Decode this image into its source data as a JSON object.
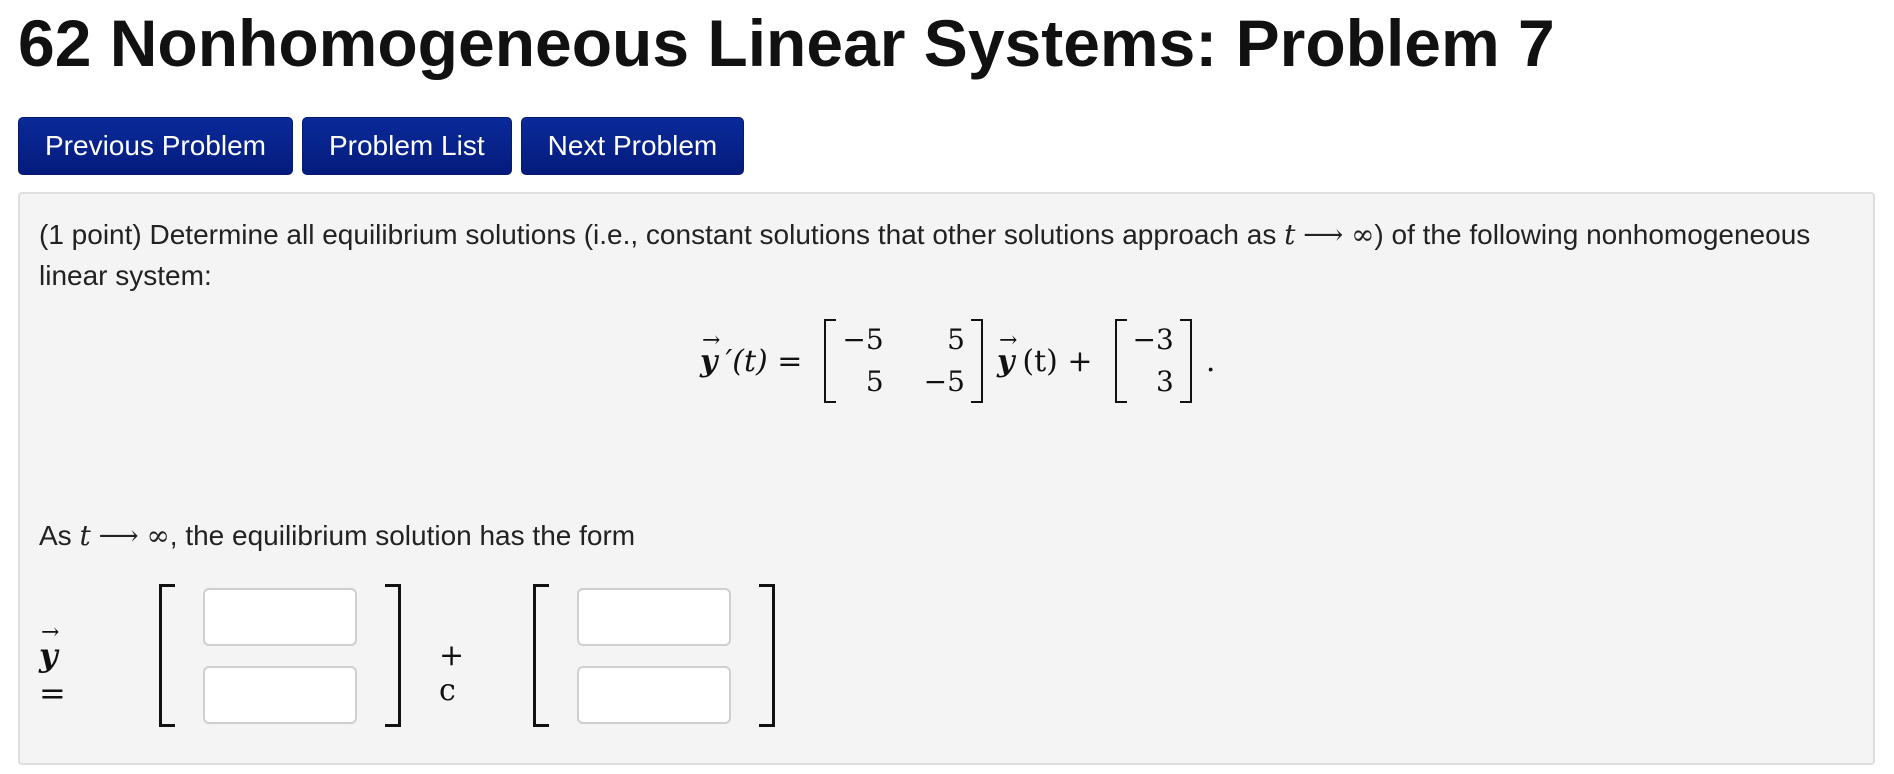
{
  "page": {
    "title": "62 Nonhomogeneous Linear Systems: Problem 7"
  },
  "nav": {
    "previous": "Previous Problem",
    "list": "Problem List",
    "next": "Next Problem"
  },
  "problem": {
    "intro_before": "(1 point) Determine all equilibrium solutions (i.e., constant solutions that other solutions approach as ",
    "t": "t",
    "arrow": "⟶",
    "infinity": "∞",
    "intro_after": ") of the following nonhomogeneous linear system:",
    "equation": {
      "y": "y",
      "vec_arrow": "→",
      "prime_t": "′(t) =",
      "matrix": [
        "−5",
        "5",
        "5",
        "−5"
      ],
      "y_of_t": "(t) +",
      "constant": [
        "−3",
        "3"
      ],
      "period": "."
    },
    "as_before": "As ",
    "as_after": ", the equilibrium solution has the form",
    "answer": {
      "y": "y",
      "vec_arrow": "→",
      "equals": "=",
      "plus_c": "+ c",
      "inputs": [
        "",
        "",
        "",
        ""
      ]
    }
  }
}
